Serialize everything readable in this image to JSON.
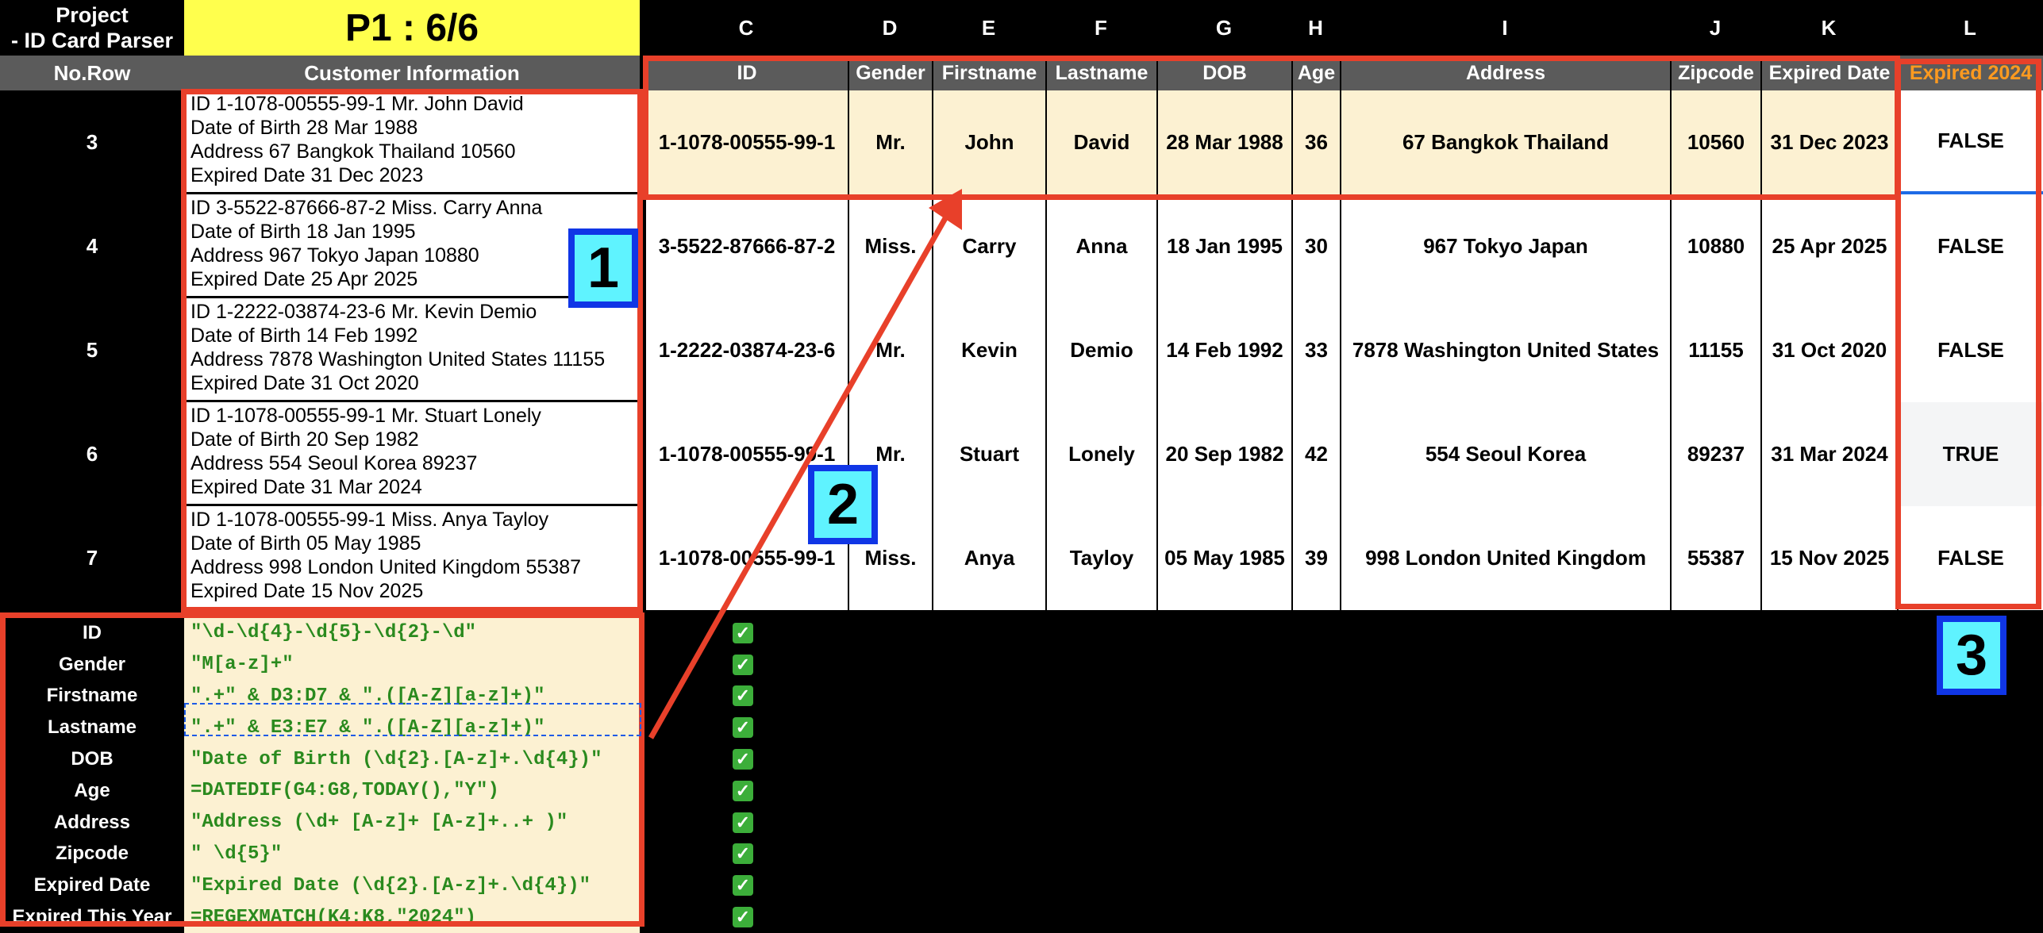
{
  "project": {
    "title_line1": "Project",
    "title_line2": "- ID Card Parser",
    "part": "P1 : 6/6"
  },
  "col_letters": [
    "C",
    "D",
    "E",
    "F",
    "G",
    "H",
    "I",
    "J",
    "K",
    "L"
  ],
  "headers": {
    "no_row": "No.Row",
    "customer_info": "Customer Information",
    "cols": [
      "ID",
      "Gender",
      "Firstname",
      "Lastname",
      "DOB",
      "Age",
      "Address",
      "Zipcode",
      "Expired Date",
      "Expired 2024"
    ]
  },
  "rows": [
    {
      "no": "3",
      "info": [
        "ID 1-1078-00555-99-1 Mr. John David",
        "Date of Birth 28 Mar 1988",
        "Address 67 Bangkok Thailand 10560",
        "Expired Date 31 Dec 2023"
      ],
      "cells": [
        "1-1078-00555-99-1",
        "Mr.",
        "John",
        "David",
        "28 Mar 1988",
        "36",
        "67 Bangkok Thailand",
        "10560",
        "31 Dec 2023",
        "FALSE"
      ]
    },
    {
      "no": "4",
      "info": [
        "ID 3-5522-87666-87-2 Miss. Carry Anna",
        "Date of Birth 18 Jan 1995",
        "Address 967 Tokyo Japan 10880",
        "Expired Date 25 Apr 2025"
      ],
      "cells": [
        "3-5522-87666-87-2",
        "Miss.",
        "Carry",
        "Anna",
        "18 Jan 1995",
        "30",
        "967 Tokyo Japan",
        "10880",
        "25 Apr 2025",
        "FALSE"
      ]
    },
    {
      "no": "5",
      "info": [
        "ID 1-2222-03874-23-6 Mr. Kevin Demio",
        "Date of Birth 14 Feb 1992",
        "Address 7878 Washington United States 11155",
        "Expired Date 31 Oct 2020"
      ],
      "cells": [
        "1-2222-03874-23-6",
        "Mr.",
        "Kevin",
        "Demio",
        "14 Feb 1992",
        "33",
        "7878 Washington United States",
        "11155",
        "31 Oct 2020",
        "FALSE"
      ]
    },
    {
      "no": "6",
      "info": [
        "ID 1-1078-00555-99-1 Mr. Stuart Lonely",
        "Date of Birth 20 Sep 1982",
        "Address 554 Seoul Korea 89237",
        "Expired Date 31 Mar 2024"
      ],
      "cells": [
        "1-1078-00555-99-1",
        "Mr.",
        "Stuart",
        "Lonely",
        "20 Sep 1982",
        "42",
        "554 Seoul Korea",
        "89237",
        "31 Mar 2024",
        "TRUE"
      ]
    },
    {
      "no": "7",
      "info": [
        "ID 1-1078-00555-99-1 Miss. Anya Tayloy",
        "Date of Birth 05 May 1985",
        "Address 998 London United Kingdom 55387",
        "Expired Date 15 Nov 2025"
      ],
      "cells": [
        "1-1078-00555-99-1",
        "Miss.",
        "Anya",
        "Tayloy",
        "05 May 1985",
        "39",
        "998 London United Kingdom",
        "55387",
        "15 Nov 2025",
        "FALSE"
      ]
    }
  ],
  "patterns": [
    {
      "label": "ID",
      "formula": "\"\\d-\\d{4}-\\d{5}-\\d{2}-\\d\""
    },
    {
      "label": "Gender",
      "formula": "\"M[a-z]+\""
    },
    {
      "label": "Firstname",
      "formula": "\".+\" & D3:D7 & \".([A-Z][a-z]+)\""
    },
    {
      "label": "Lastname",
      "formula": "\".+\" & E3:E7 & \".([A-Z][a-z]+)\""
    },
    {
      "label": "DOB",
      "formula": "\"Date of Birth (\\d{2}.[A-z]+.\\d{4})\""
    },
    {
      "label": "Age",
      "formula": "=DATEDIF(G4:G8,TODAY(),\"Y\")"
    },
    {
      "label": "Address",
      "formula": "\"Address (\\d+ [A-z]+ [A-z]+..+ )\""
    },
    {
      "label": "Zipcode",
      "formula": "\" \\d{5}\""
    },
    {
      "label": "Expired Date",
      "formula": "\"Expired Date (\\d{2}.[A-z]+.\\d{4})\""
    },
    {
      "label": "Expired This Year",
      "formula": "=REGEXMATCH(K4:K8,\"2024\")"
    }
  ],
  "check_mark": "✓",
  "badges": [
    "1",
    "2",
    "3"
  ],
  "colors": {
    "yellow": "#ffff4d",
    "header_gray": "#5b5b5b",
    "highlight_row": "#fcf1d2",
    "formula_bg": "#fcf1d2",
    "red": "#e8402a",
    "blue": "#1036e6",
    "cyan": "#5ff3ff",
    "orange": "#ff9a1f",
    "green": "#2a8a1e"
  }
}
